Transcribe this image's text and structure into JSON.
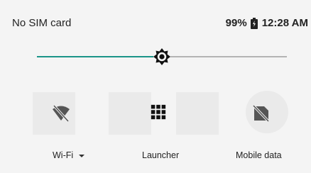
{
  "status_bar": {
    "carrier": "No SIM card",
    "battery_percent": "99%",
    "time": "12:28 AM",
    "icons": [
      "battery-icon"
    ]
  },
  "brightness": {
    "level_fraction": 0.5,
    "colors": {
      "active": "#1b9488",
      "inactive": "#b3b3b3"
    },
    "icon": "brightness-icon"
  },
  "tiles": [
    {
      "label": "Wi-Fi",
      "icon": "wifi-off-icon",
      "has_dropdown": true
    },
    {
      "label": "Launcher",
      "icon": "grid-icon",
      "has_dropdown": false
    },
    {
      "label": "Mobile data",
      "icon": "mobile-data-off-icon",
      "has_dropdown": false
    }
  ]
}
